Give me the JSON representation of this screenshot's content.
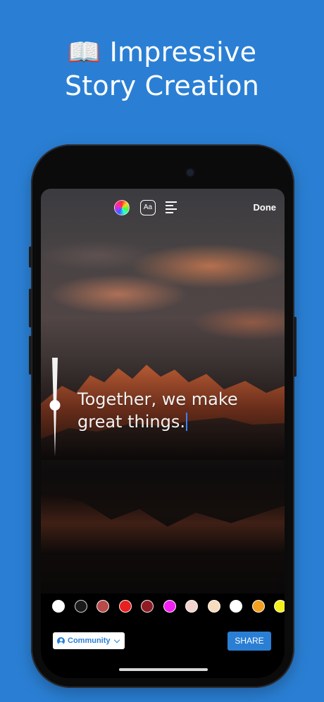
{
  "headline": {
    "icon": "📖",
    "line1": "Impressive",
    "line2": "Story Creation"
  },
  "toolbar": {
    "color_icon": "color-wheel-icon",
    "font_label": "Aa",
    "align_icon": "text-align-left-icon",
    "done_label": "Done"
  },
  "story": {
    "line1": "Together, we make",
    "line2": "great things."
  },
  "text_size_level": 0.52,
  "palette": [
    "#ffffff",
    "#1a1a1a",
    "#b84a4a",
    "#e82020",
    "#8f1c22",
    "#f21ef2",
    "#f3d3cd",
    "#f6dcbd",
    "#ffffff",
    "#f5a01f",
    "#f3f01d"
  ],
  "bottom": {
    "audience_label": "Community",
    "share_label": "SHARE"
  },
  "colors": {
    "background": "#2a7fd4",
    "accent": "#2a7fd4",
    "caret": "#3b82f6"
  }
}
